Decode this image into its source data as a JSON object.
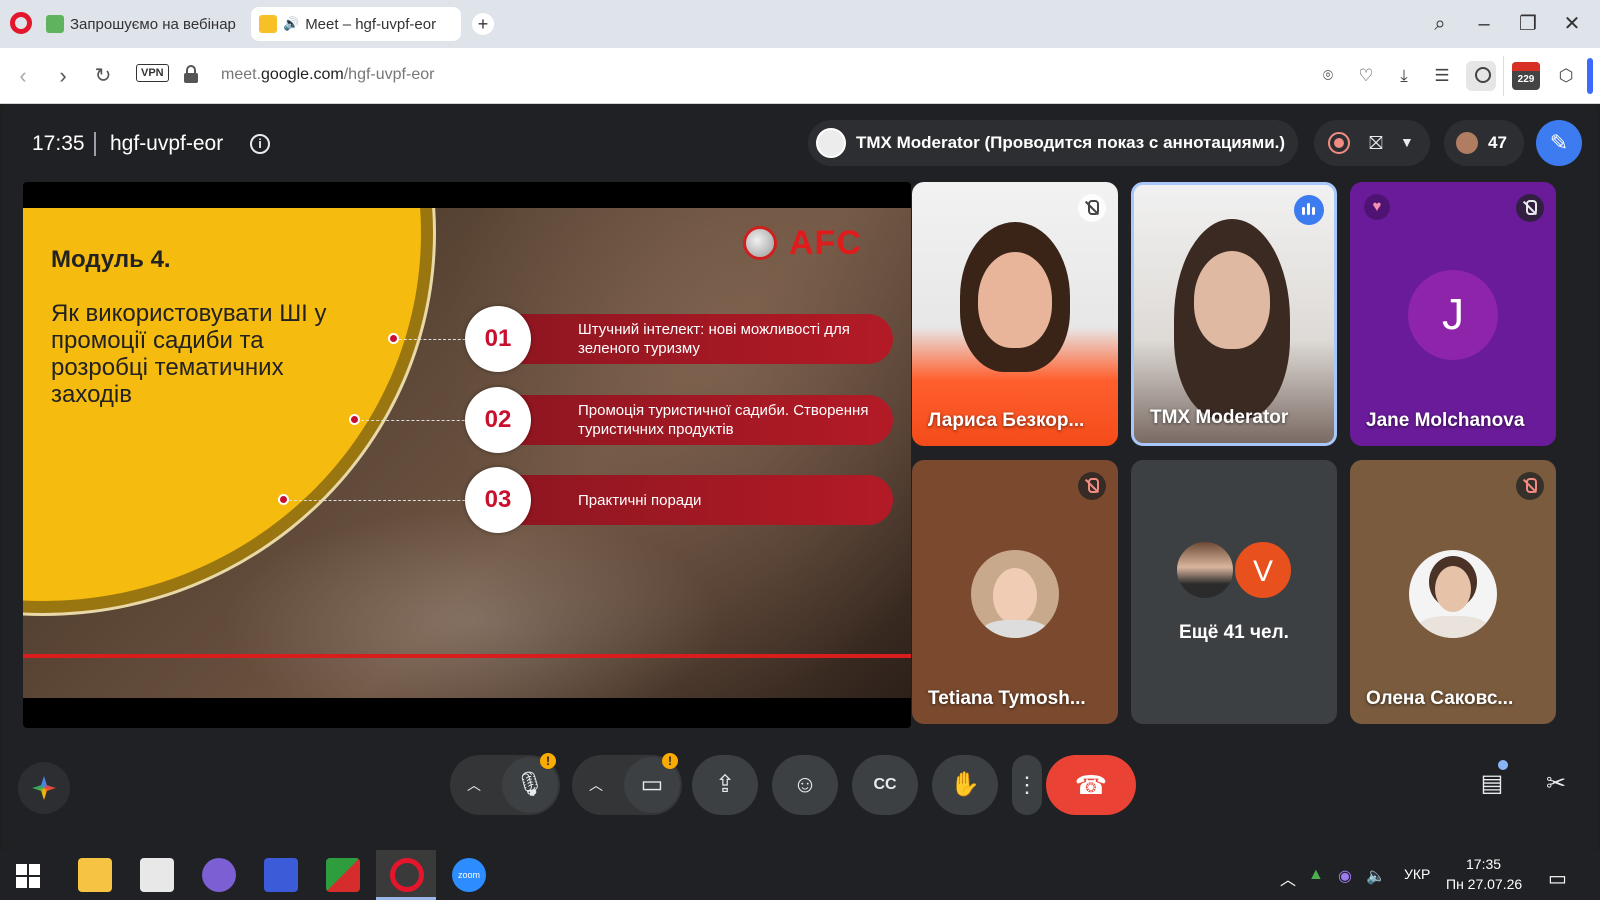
{
  "browser": {
    "tabs": [
      {
        "title": "Запрошуємо на вебінар",
        "icon": "mail-tab-icon"
      },
      {
        "title": "Meet – hgf-uvpf-eor",
        "icon": "meet-tab-icon",
        "audio": true
      }
    ],
    "new_tab": "+",
    "url_prefix": "meet.",
    "url_host": "google.com",
    "url_path": "/hgf-uvpf-eor",
    "vpn_label": "VPN",
    "extension_badge": "229"
  },
  "meet": {
    "time": "17:35",
    "code": "hgf-uvpf-eor",
    "presenter_text": "TMX Moderator (Проводится показ с аннотациями.)",
    "participant_count": "47"
  },
  "slide": {
    "module": "Модуль 4.",
    "title": "Як використовувати ШІ у промоції садиби та розробці тематичних заходів",
    "logo_text": "AFC",
    "items": [
      {
        "num": "01",
        "text": "Штучний інтелект: нові можливості для зеленого туризму"
      },
      {
        "num": "02",
        "text": "Промоція туристичної садиби. Створення туристичних продуктів"
      },
      {
        "num": "03",
        "text": "Практичні поради"
      }
    ],
    "colors": {
      "accent": "#c8102e",
      "disc": "#f6bb0f"
    }
  },
  "participants": [
    {
      "name": "Лариса Безкор...",
      "muted": true
    },
    {
      "name": "TMX Moderator",
      "speaking": true
    },
    {
      "name": "Jane Molchanova",
      "initial": "J",
      "muted": true,
      "reaction": "heart"
    },
    {
      "name": "Tetiana Tymosh...",
      "muted": true
    },
    {
      "more_text": "Ещё 41 чел.",
      "initial": "V"
    },
    {
      "name": "Олена Саковс...",
      "muted": true
    }
  ],
  "controls": {
    "warning": "!"
  },
  "taskbar": {
    "time": "17:35",
    "date": "Пн 27.07.26",
    "lang": "УКР",
    "zoom_label": "zoom"
  }
}
